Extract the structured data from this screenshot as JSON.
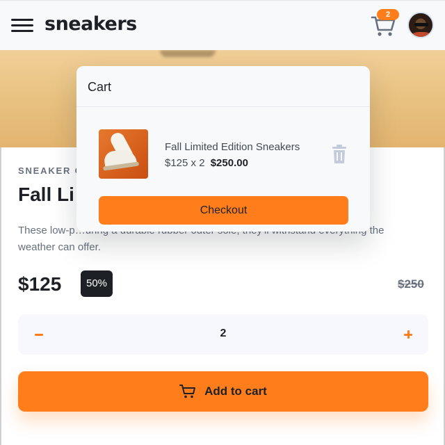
{
  "header": {
    "logo": "sneakers",
    "cart_count": "2"
  },
  "product": {
    "company": "SNEAKER C",
    "title": "Fall Li",
    "description": "These low-p…uring a durable rubber outer sole, they'll withstand everything the weather can offer.",
    "price": "$125",
    "discount": "50%",
    "old_price": "$250",
    "quantity": "2",
    "add_to_cart_label": "Add to cart"
  },
  "cart": {
    "title": "Cart",
    "items": [
      {
        "name": "Fall Limited Edition Sneakers",
        "unit_calc": "$125 x 2",
        "total": "$250.00"
      }
    ],
    "checkout_label": "Checkout"
  },
  "colors": {
    "accent": "#ff7e1b",
    "dark": "#1d2025",
    "muted": "#68707d"
  },
  "icons": [
    "menu-icon",
    "cart-icon",
    "avatar-image",
    "trash-icon",
    "minus-icon",
    "plus-icon"
  ]
}
